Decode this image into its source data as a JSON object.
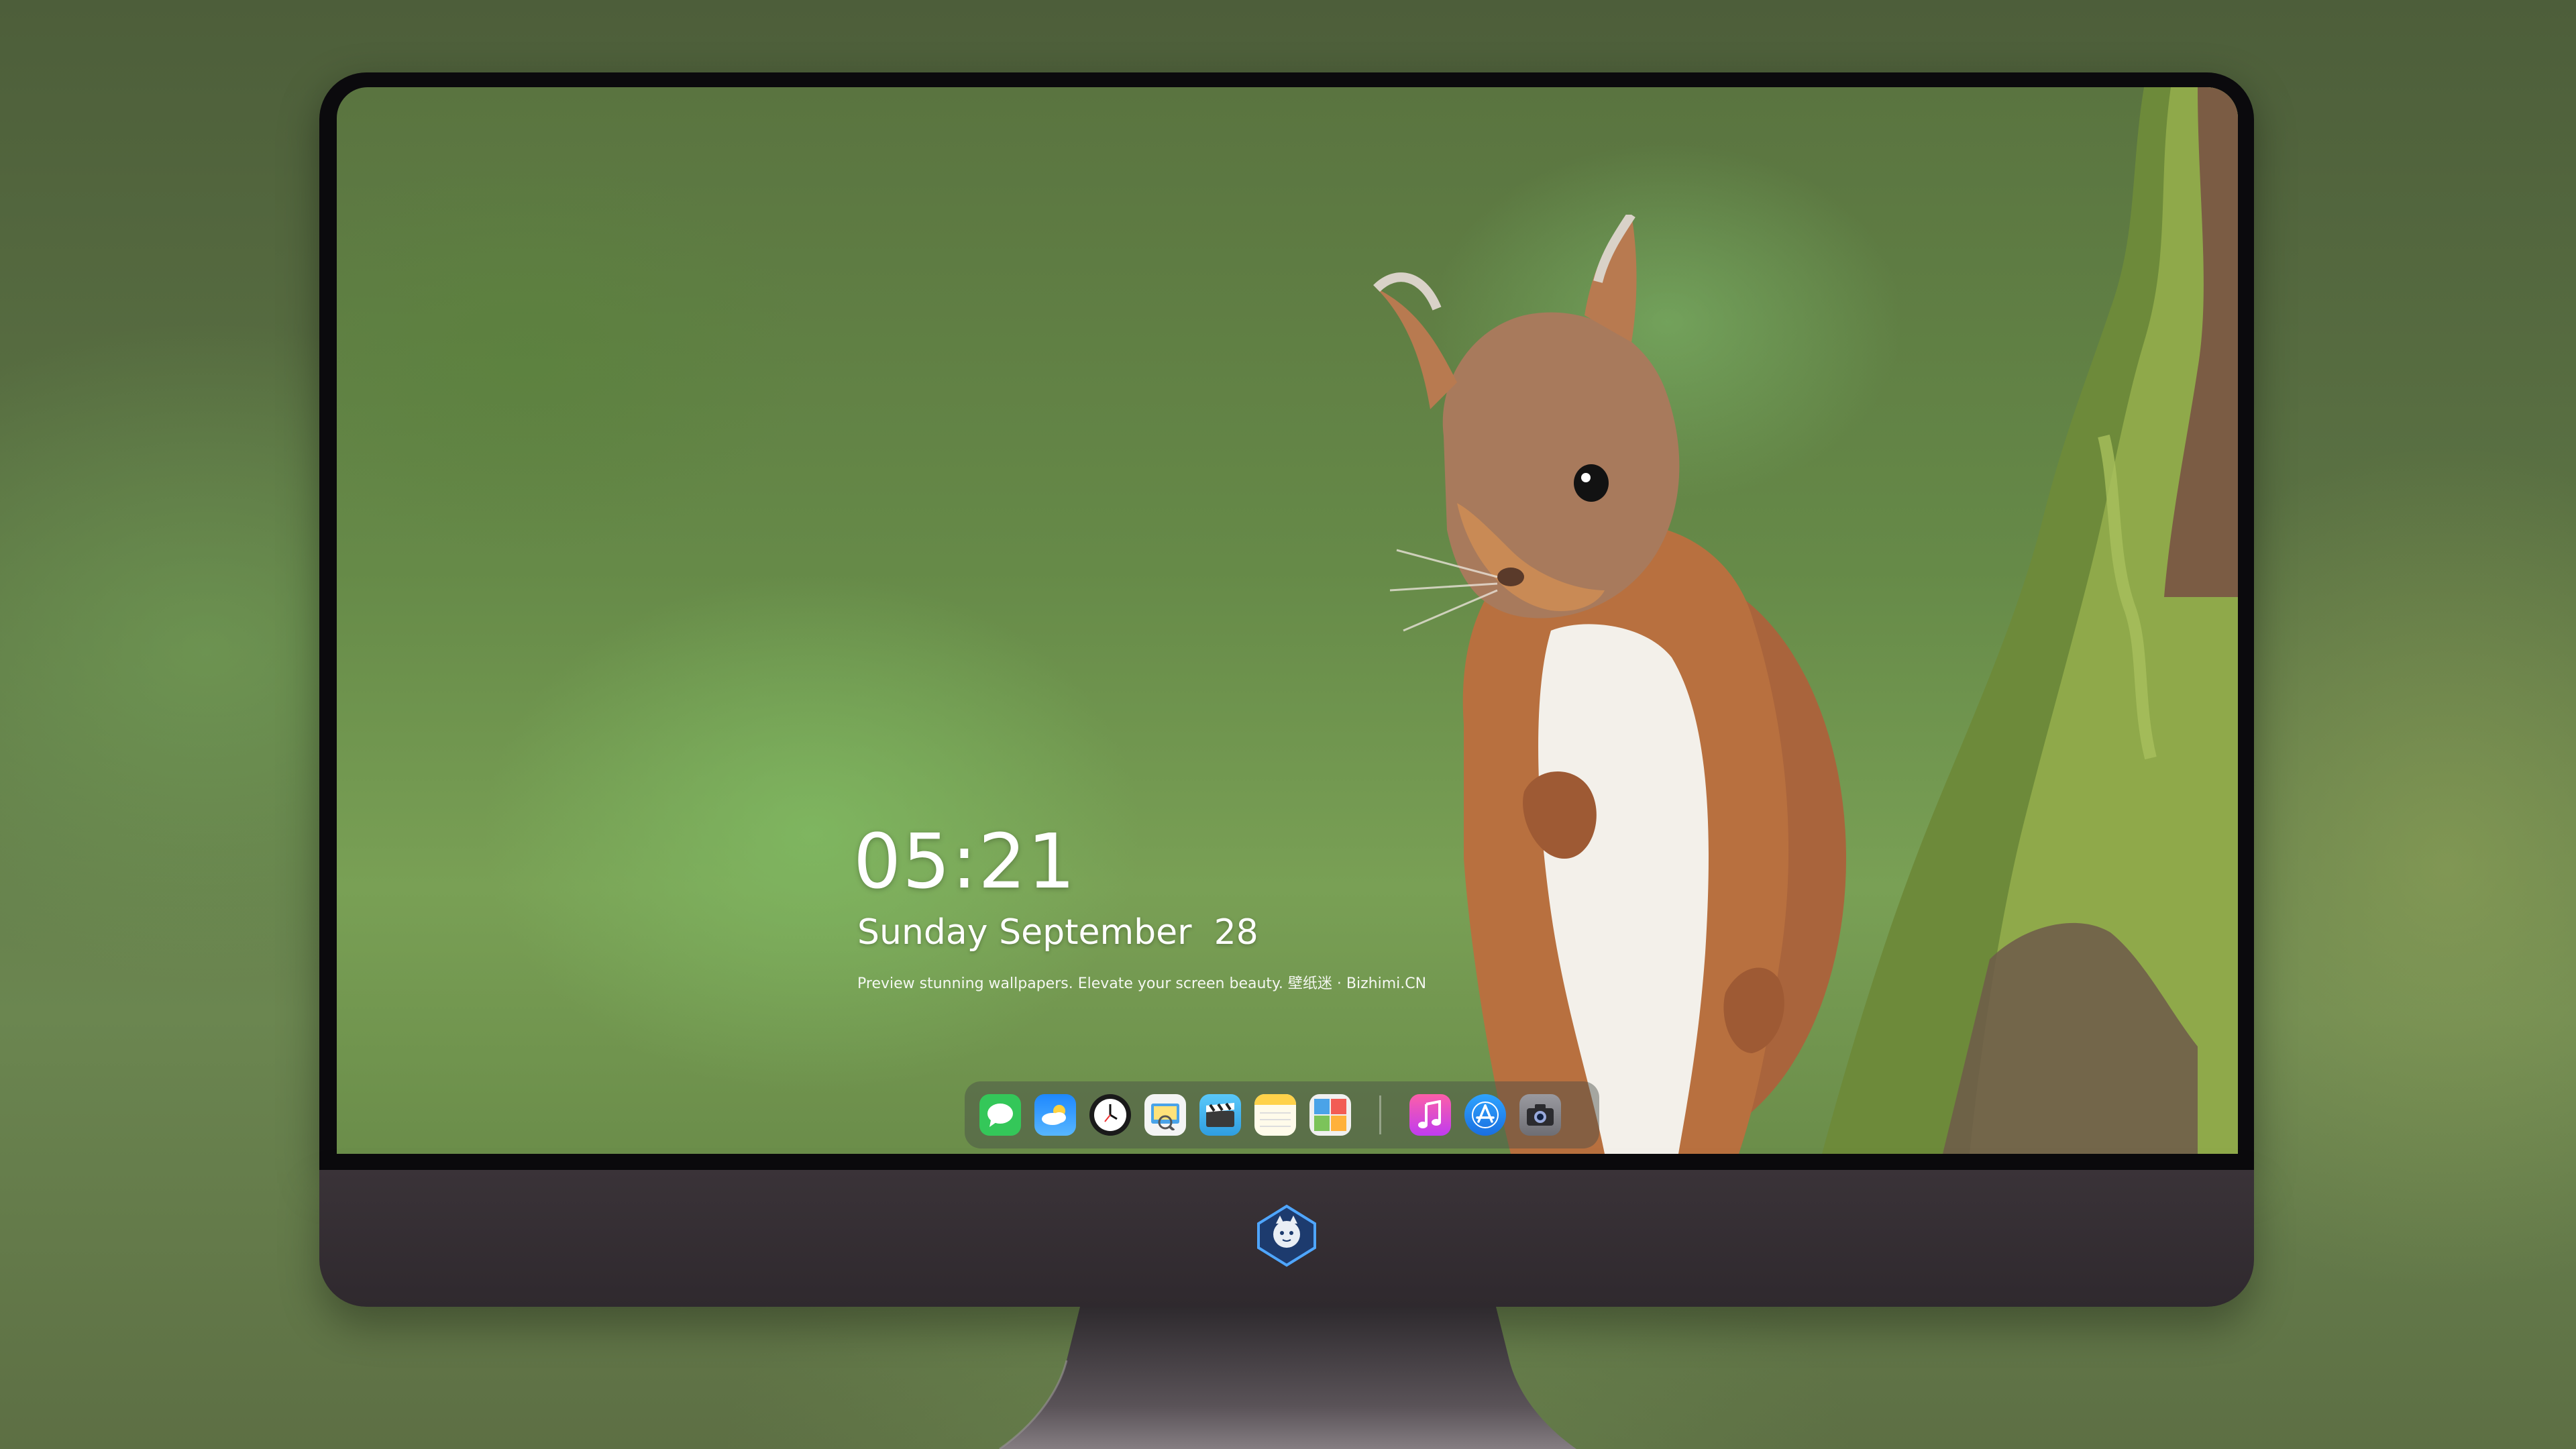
{
  "clock": {
    "time": "05:21",
    "date": "Sunday September  28",
    "tagline": "Preview stunning wallpapers. Elevate your screen beauty. 壁纸迷 · Bizhimi.CN"
  },
  "dock": {
    "apps": [
      {
        "name": "messages-icon",
        "color": "#34c759"
      },
      {
        "name": "weather-icon",
        "color": "#1e88ff"
      },
      {
        "name": "clock-icon",
        "color": "#1a1a1a"
      },
      {
        "name": "preview-icon",
        "color": "#f4f4f4"
      },
      {
        "name": "clips-icon",
        "color": "#5ac8fa"
      },
      {
        "name": "notes-icon",
        "color": "#ffd24a"
      },
      {
        "name": "photo-booth-icon",
        "color": "#f0f0f0"
      },
      {
        "name": "music-icon",
        "color": "#fc3c8d"
      },
      {
        "name": "app-store-icon",
        "color": "#1e88ff"
      },
      {
        "name": "camera-icon",
        "color": "#8e8e93"
      }
    ]
  }
}
